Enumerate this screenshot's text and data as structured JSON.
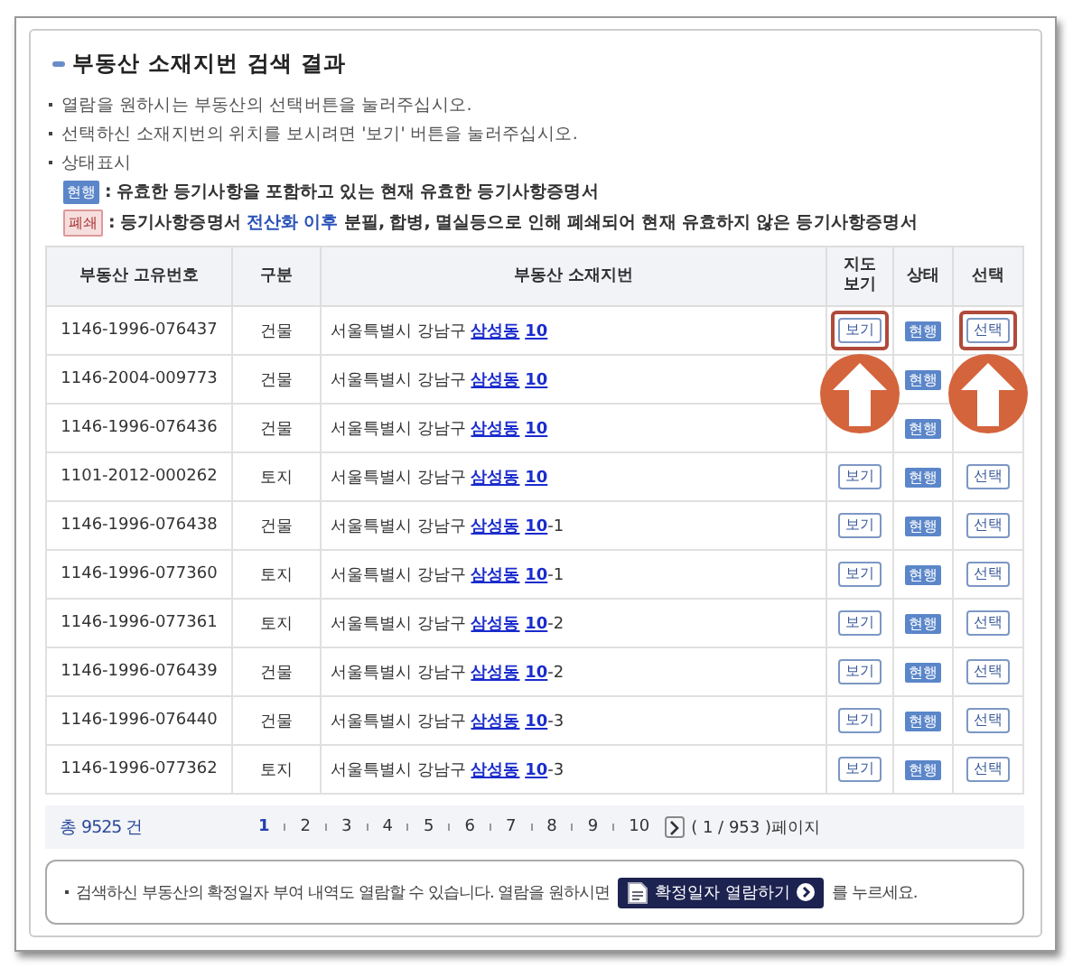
{
  "title": "부동산 소재지번 검색 결과",
  "instructions": [
    "열람을 원하시는 부동산의 선택버튼을 눌러주십시오.",
    "선택하신 소재지번의 위치를 보시려면 '보기' 버튼을 눌러주십시오.",
    "상태표시"
  ],
  "legend": [
    {
      "badge": "현행",
      "kind": "current",
      "before": ": 유효한 등기사항을 포함하고 있는 현재 유효한 등기사항증명서"
    },
    {
      "badge": "폐쇄",
      "kind": "closed",
      "before": ": 등기사항증명서 ",
      "highlight": "전산화 이후",
      "after": " 분필, 합병, 멸실등으로 인해 폐쇄되어 현재 유효하지 않은 등기사항증명서"
    }
  ],
  "table": {
    "columns": [
      "부동산 고유번호",
      "구분",
      "부동산 소재지번",
      "지도\n보기",
      "상태",
      "선택"
    ],
    "rows": [
      {
        "id": "1146-1996-076437",
        "type": "건물",
        "address": "서울특별시 강남구 ",
        "dong": "삼성동",
        "lot": "10",
        "map_button": "보기",
        "status": "현행",
        "select_button": "선택",
        "highlighted": true
      },
      {
        "id": "1146-2004-009773",
        "type": "건물",
        "address": "서울특별시 강남구 ",
        "dong": "삼성동",
        "lot": "10",
        "status": "현행",
        "highlighted": false
      },
      {
        "id": "1146-1996-076436",
        "type": "건물",
        "address": "서울특별시 강남구 ",
        "dong": "삼성동",
        "lot": "10",
        "status": "현행",
        "highlighted": false
      },
      {
        "id": "1101-2012-000262",
        "type": "토지",
        "address": "서울특별시 강남구 ",
        "dong": "삼성동",
        "lot": "10",
        "map_button": "보기",
        "status": "현행",
        "select_button": "선택",
        "highlighted": false
      },
      {
        "id": "1146-1996-076438",
        "type": "건물",
        "address": "서울특별시 강남구 ",
        "dong": "삼성동",
        "lot": "10",
        "suffix": "-1",
        "map_button": "보기",
        "status": "현행",
        "select_button": "선택",
        "highlighted": false
      },
      {
        "id": "1146-1996-077360",
        "type": "토지",
        "address": "서울특별시 강남구 ",
        "dong": "삼성동",
        "lot": "10",
        "suffix": "-1",
        "map_button": "보기",
        "status": "현행",
        "select_button": "선택",
        "highlighted": false
      },
      {
        "id": "1146-1996-077361",
        "type": "토지",
        "address": "서울특별시 강남구 ",
        "dong": "삼성동",
        "lot": "10",
        "suffix": "-2",
        "map_button": "보기",
        "status": "현행",
        "select_button": "선택",
        "highlighted": false
      },
      {
        "id": "1146-1996-076439",
        "type": "건물",
        "address": "서울특별시 강남구 ",
        "dong": "삼성동",
        "lot": "10",
        "suffix": "-2",
        "map_button": "보기",
        "status": "현행",
        "select_button": "선택",
        "highlighted": false
      },
      {
        "id": "1146-1996-076440",
        "type": "건물",
        "address": "서울특별시 강남구 ",
        "dong": "삼성동",
        "lot": "10",
        "suffix": "-3",
        "map_button": "보기",
        "status": "현행",
        "select_button": "선택",
        "highlighted": false
      },
      {
        "id": "1146-1996-077362",
        "type": "토지",
        "address": "서울특별시 강남구 ",
        "dong": "삼성동",
        "lot": "10",
        "suffix": "-3",
        "map_button": "보기",
        "status": "현행",
        "select_button": "선택",
        "highlighted": false
      }
    ]
  },
  "pagination": {
    "total": "총 9525 건",
    "pages": [
      {
        "label": "1",
        "selected": true
      },
      {
        "label": "2",
        "selected": false
      },
      {
        "label": "3",
        "selected": false
      },
      {
        "label": "4",
        "selected": false
      },
      {
        "label": "5",
        "selected": false
      },
      {
        "label": "6",
        "selected": false
      },
      {
        "label": "7",
        "selected": false
      },
      {
        "label": "8",
        "selected": false
      },
      {
        "label": "9",
        "selected": false
      },
      {
        "label": "10",
        "selected": false
      }
    ],
    "page_info": "( 1 / 953 )페이지"
  },
  "note": {
    "before": "검색하신 부동산의 확정일자 부여 내역도 열람할 수 있습니다. 열람을 원하시면",
    "button": "확정일자 열람하기",
    "after": "를 누르세요."
  }
}
